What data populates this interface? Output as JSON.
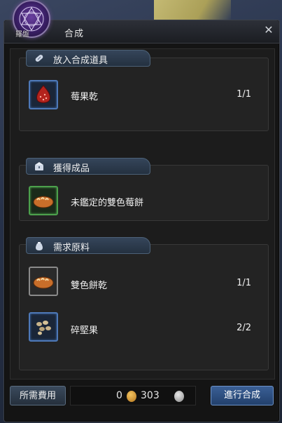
{
  "window": {
    "title": "合成",
    "emblem_label": "羅盤",
    "close_icon": "close-icon"
  },
  "sections": {
    "input": {
      "tab_label": "放入合成道具",
      "icon": "pill-icon",
      "items": [
        {
          "name": "莓果乾",
          "count": "1/1",
          "icon": "red-berry-icon"
        }
      ]
    },
    "output": {
      "tab_label": "獲得成品",
      "icon": "chest-icon",
      "items": [
        {
          "name": "未鑑定的雙色莓餅",
          "icon": "bread-icon"
        }
      ]
    },
    "materials": {
      "tab_label": "需求原料",
      "icon": "bag-icon",
      "items": [
        {
          "name": "雙色餅乾",
          "count": "1/1",
          "icon": "bread-icon"
        },
        {
          "name": "碎堅果",
          "count": "2/2",
          "icon": "nuts-icon"
        }
      ]
    }
  },
  "footer": {
    "fee_label": "所需費用",
    "gold_amount": "0",
    "silver_amount": "303",
    "craft_button_label": "進行合成"
  },
  "colors": {
    "tab_blue": "#35455a",
    "slot_blue": "#4e79b8",
    "slot_green": "#4ca04c",
    "craft_button": "#3a5f95"
  }
}
